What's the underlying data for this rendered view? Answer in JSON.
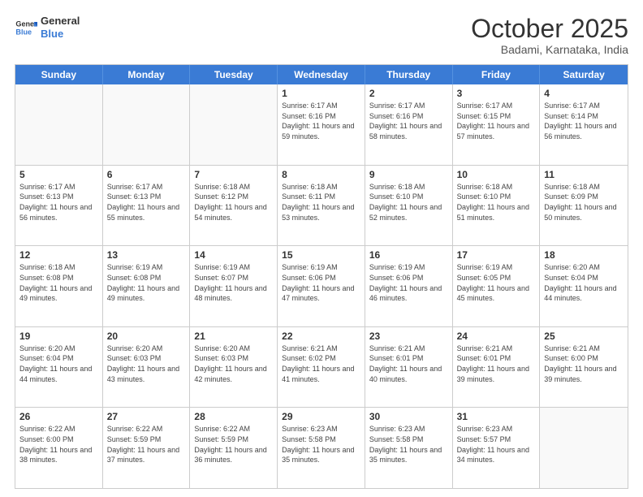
{
  "header": {
    "logo_general": "General",
    "logo_blue": "Blue",
    "month": "October 2025",
    "location": "Badami, Karnataka, India"
  },
  "days_of_week": [
    "Sunday",
    "Monday",
    "Tuesday",
    "Wednesday",
    "Thursday",
    "Friday",
    "Saturday"
  ],
  "weeks": [
    [
      {
        "day": "",
        "sunrise": "",
        "sunset": "",
        "daylight": ""
      },
      {
        "day": "",
        "sunrise": "",
        "sunset": "",
        "daylight": ""
      },
      {
        "day": "",
        "sunrise": "",
        "sunset": "",
        "daylight": ""
      },
      {
        "day": "1",
        "sunrise": "Sunrise: 6:17 AM",
        "sunset": "Sunset: 6:16 PM",
        "daylight": "Daylight: 11 hours and 59 minutes."
      },
      {
        "day": "2",
        "sunrise": "Sunrise: 6:17 AM",
        "sunset": "Sunset: 6:16 PM",
        "daylight": "Daylight: 11 hours and 58 minutes."
      },
      {
        "day": "3",
        "sunrise": "Sunrise: 6:17 AM",
        "sunset": "Sunset: 6:15 PM",
        "daylight": "Daylight: 11 hours and 57 minutes."
      },
      {
        "day": "4",
        "sunrise": "Sunrise: 6:17 AM",
        "sunset": "Sunset: 6:14 PM",
        "daylight": "Daylight: 11 hours and 56 minutes."
      }
    ],
    [
      {
        "day": "5",
        "sunrise": "Sunrise: 6:17 AM",
        "sunset": "Sunset: 6:13 PM",
        "daylight": "Daylight: 11 hours and 56 minutes."
      },
      {
        "day": "6",
        "sunrise": "Sunrise: 6:17 AM",
        "sunset": "Sunset: 6:13 PM",
        "daylight": "Daylight: 11 hours and 55 minutes."
      },
      {
        "day": "7",
        "sunrise": "Sunrise: 6:18 AM",
        "sunset": "Sunset: 6:12 PM",
        "daylight": "Daylight: 11 hours and 54 minutes."
      },
      {
        "day": "8",
        "sunrise": "Sunrise: 6:18 AM",
        "sunset": "Sunset: 6:11 PM",
        "daylight": "Daylight: 11 hours and 53 minutes."
      },
      {
        "day": "9",
        "sunrise": "Sunrise: 6:18 AM",
        "sunset": "Sunset: 6:10 PM",
        "daylight": "Daylight: 11 hours and 52 minutes."
      },
      {
        "day": "10",
        "sunrise": "Sunrise: 6:18 AM",
        "sunset": "Sunset: 6:10 PM",
        "daylight": "Daylight: 11 hours and 51 minutes."
      },
      {
        "day": "11",
        "sunrise": "Sunrise: 6:18 AM",
        "sunset": "Sunset: 6:09 PM",
        "daylight": "Daylight: 11 hours and 50 minutes."
      }
    ],
    [
      {
        "day": "12",
        "sunrise": "Sunrise: 6:18 AM",
        "sunset": "Sunset: 6:08 PM",
        "daylight": "Daylight: 11 hours and 49 minutes."
      },
      {
        "day": "13",
        "sunrise": "Sunrise: 6:19 AM",
        "sunset": "Sunset: 6:08 PM",
        "daylight": "Daylight: 11 hours and 49 minutes."
      },
      {
        "day": "14",
        "sunrise": "Sunrise: 6:19 AM",
        "sunset": "Sunset: 6:07 PM",
        "daylight": "Daylight: 11 hours and 48 minutes."
      },
      {
        "day": "15",
        "sunrise": "Sunrise: 6:19 AM",
        "sunset": "Sunset: 6:06 PM",
        "daylight": "Daylight: 11 hours and 47 minutes."
      },
      {
        "day": "16",
        "sunrise": "Sunrise: 6:19 AM",
        "sunset": "Sunset: 6:06 PM",
        "daylight": "Daylight: 11 hours and 46 minutes."
      },
      {
        "day": "17",
        "sunrise": "Sunrise: 6:19 AM",
        "sunset": "Sunset: 6:05 PM",
        "daylight": "Daylight: 11 hours and 45 minutes."
      },
      {
        "day": "18",
        "sunrise": "Sunrise: 6:20 AM",
        "sunset": "Sunset: 6:04 PM",
        "daylight": "Daylight: 11 hours and 44 minutes."
      }
    ],
    [
      {
        "day": "19",
        "sunrise": "Sunrise: 6:20 AM",
        "sunset": "Sunset: 6:04 PM",
        "daylight": "Daylight: 11 hours and 44 minutes."
      },
      {
        "day": "20",
        "sunrise": "Sunrise: 6:20 AM",
        "sunset": "Sunset: 6:03 PM",
        "daylight": "Daylight: 11 hours and 43 minutes."
      },
      {
        "day": "21",
        "sunrise": "Sunrise: 6:20 AM",
        "sunset": "Sunset: 6:03 PM",
        "daylight": "Daylight: 11 hours and 42 minutes."
      },
      {
        "day": "22",
        "sunrise": "Sunrise: 6:21 AM",
        "sunset": "Sunset: 6:02 PM",
        "daylight": "Daylight: 11 hours and 41 minutes."
      },
      {
        "day": "23",
        "sunrise": "Sunrise: 6:21 AM",
        "sunset": "Sunset: 6:01 PM",
        "daylight": "Daylight: 11 hours and 40 minutes."
      },
      {
        "day": "24",
        "sunrise": "Sunrise: 6:21 AM",
        "sunset": "Sunset: 6:01 PM",
        "daylight": "Daylight: 11 hours and 39 minutes."
      },
      {
        "day": "25",
        "sunrise": "Sunrise: 6:21 AM",
        "sunset": "Sunset: 6:00 PM",
        "daylight": "Daylight: 11 hours and 39 minutes."
      }
    ],
    [
      {
        "day": "26",
        "sunrise": "Sunrise: 6:22 AM",
        "sunset": "Sunset: 6:00 PM",
        "daylight": "Daylight: 11 hours and 38 minutes."
      },
      {
        "day": "27",
        "sunrise": "Sunrise: 6:22 AM",
        "sunset": "Sunset: 5:59 PM",
        "daylight": "Daylight: 11 hours and 37 minutes."
      },
      {
        "day": "28",
        "sunrise": "Sunrise: 6:22 AM",
        "sunset": "Sunset: 5:59 PM",
        "daylight": "Daylight: 11 hours and 36 minutes."
      },
      {
        "day": "29",
        "sunrise": "Sunrise: 6:23 AM",
        "sunset": "Sunset: 5:58 PM",
        "daylight": "Daylight: 11 hours and 35 minutes."
      },
      {
        "day": "30",
        "sunrise": "Sunrise: 6:23 AM",
        "sunset": "Sunset: 5:58 PM",
        "daylight": "Daylight: 11 hours and 35 minutes."
      },
      {
        "day": "31",
        "sunrise": "Sunrise: 6:23 AM",
        "sunset": "Sunset: 5:57 PM",
        "daylight": "Daylight: 11 hours and 34 minutes."
      },
      {
        "day": "",
        "sunrise": "",
        "sunset": "",
        "daylight": ""
      }
    ]
  ]
}
